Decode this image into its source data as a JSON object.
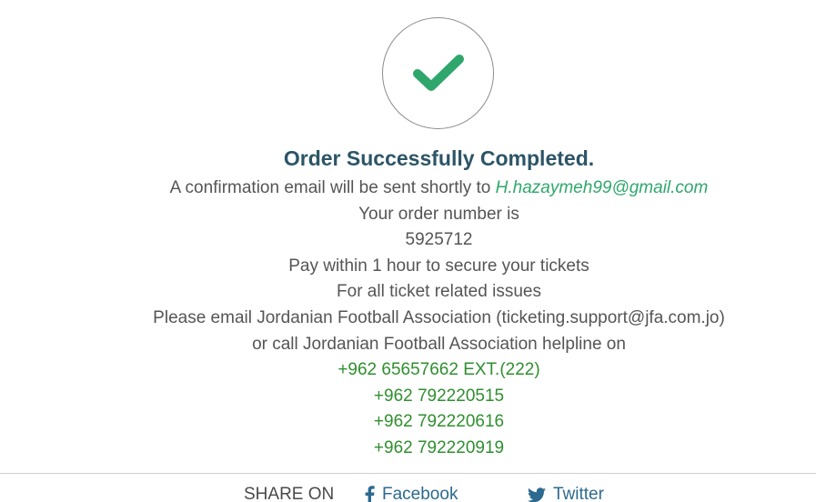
{
  "confirmation": {
    "title": "Order Successfully Completed.",
    "email_intro": "A confirmation email will be sent shortly to",
    "email": "H.hazaymeh99@gmail.com",
    "order_number_label": "Your order number is",
    "order_number": "5925712",
    "payment_notice": "Pay within 1 hour to secure your tickets",
    "support_heading": "For all ticket related issues",
    "support_email_line": "Please email Jordanian Football Association (ticketing.support@jfa.com.jo)",
    "helpline_line": "or call Jordanian Football Association helpline on",
    "phones": [
      "+962 65657662 EXT.(222)",
      "+962 792220515",
      "+962 792220616",
      "+962 792220919"
    ]
  },
  "share": {
    "label": "SHARE ON",
    "facebook": "Facebook",
    "twitter": "Twitter"
  },
  "icons": {
    "success": "check-icon",
    "facebook": "facebook-icon",
    "twitter": "twitter-icon"
  },
  "colors": {
    "title": "#2c5567",
    "check": "#2fa76c",
    "email": "#2fa76c",
    "phone": "#2f8f2f",
    "share_link": "#2c6a8f",
    "body_text": "#555555"
  }
}
